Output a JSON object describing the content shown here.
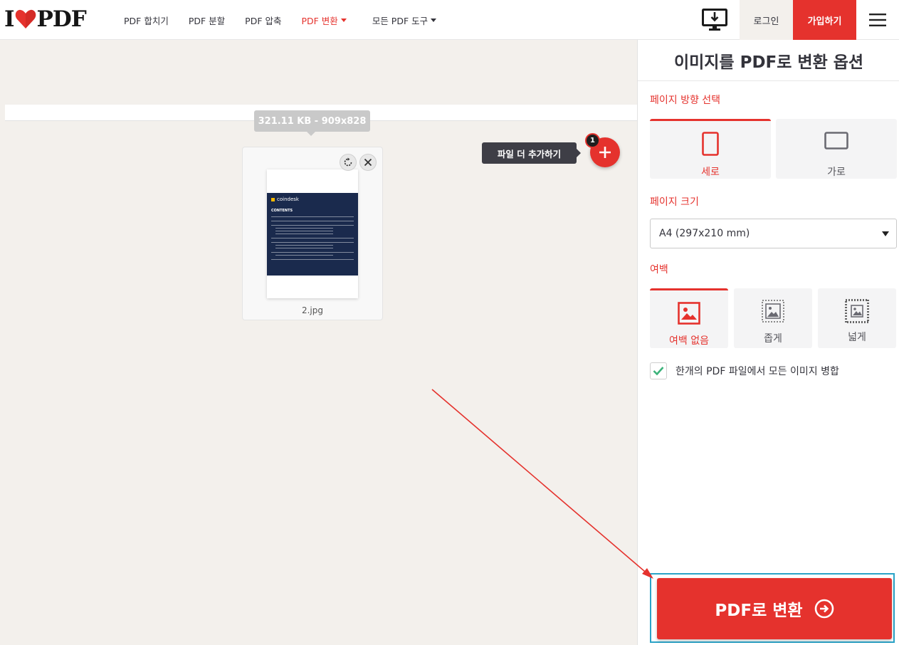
{
  "header": {
    "logo": {
      "left": "I",
      "right": "PDF"
    },
    "nav": {
      "merge": "PDF 합치기",
      "split": "PDF 분할",
      "compress": "PDF 압축",
      "convert": "PDF 변환",
      "all_tools": "모든 PDF 도구"
    },
    "login": "로그인",
    "signup": "가입하기"
  },
  "workspace": {
    "file_info": "321.11 KB - 909x828",
    "thumbnail": {
      "brand": "coindesk",
      "heading": "CONTENTS"
    },
    "file_name": "2.jpg",
    "add_more_label": "파일 더 추가하기",
    "file_count": "1"
  },
  "sidebar": {
    "title": "이미지를 PDF로 변환 옵션",
    "orientation": {
      "label": "페이지 방향 선택",
      "options": [
        "세로",
        "가로"
      ],
      "selected": "세로"
    },
    "page_size": {
      "label": "페이지 크기",
      "value": "A4 (297x210 mm)"
    },
    "margin": {
      "label": "여백",
      "options": [
        "여백 없음",
        "좁게",
        "넓게"
      ],
      "selected": "여백 없음"
    },
    "merge_checkbox": "한개의 PDF 파일에서 모든 이미지 병합",
    "convert_button": "PDF로 변환"
  },
  "colors": {
    "accent": "#e5322d",
    "background": "#f3f0ec",
    "highlight": "#2aa3c7"
  }
}
